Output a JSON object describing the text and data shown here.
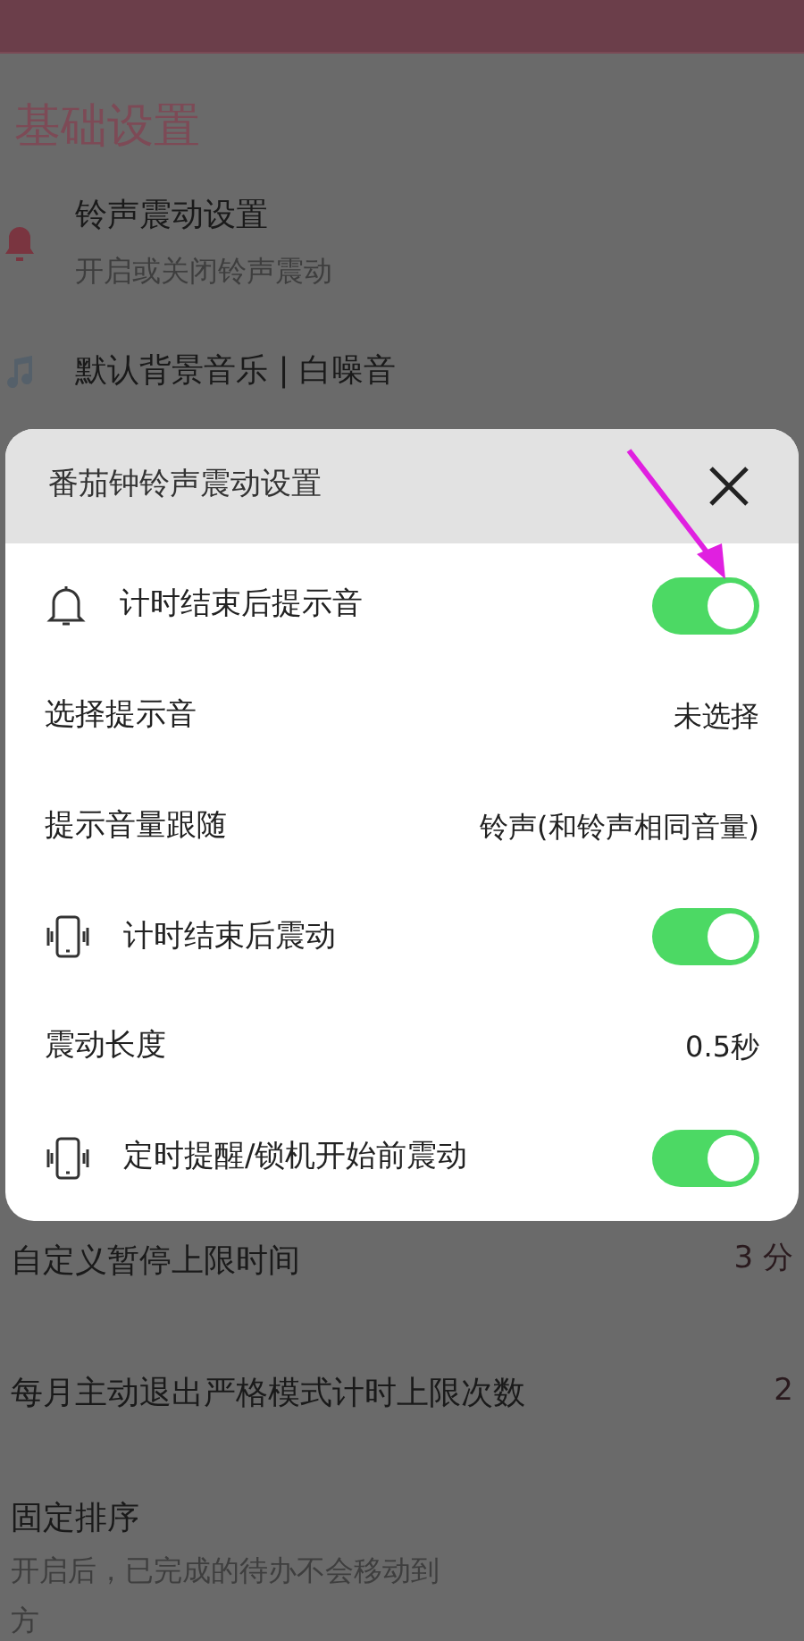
{
  "page": {
    "section_title": "基础设置",
    "items": [
      {
        "kind": "bell",
        "title": "铃声震动设置",
        "subtitle": "开启或关闭铃声震动"
      },
      {
        "kind": "music",
        "title": "默认背景音乐 | 白噪音"
      }
    ],
    "rows_below": [
      {
        "title": "自定义暂停上限时间",
        "value": "3 分"
      },
      {
        "title": "每月主动退出严格模式计时上限次数",
        "value": "2"
      },
      {
        "title": "固定排序",
        "lines": [
          "开启后，已完成的待办不会移动到",
          "方"
        ]
      }
    ]
  },
  "dialog": {
    "title": "番茄钟铃声震动设置",
    "rows": [
      {
        "kind": "bell_toggle",
        "label": "计时结束后提示音",
        "on": true
      },
      {
        "kind": "value",
        "label": "选择提示音",
        "value": "未选择"
      },
      {
        "kind": "value",
        "label": "提示音量跟随",
        "value": "铃声(和铃声相同音量)"
      },
      {
        "kind": "phone_toggle",
        "label": "计时结束后震动",
        "on": true
      },
      {
        "kind": "value",
        "label": "震动长度",
        "value": "0.5秒"
      },
      {
        "kind": "phone_toggle",
        "label": "定时提醒/锁机开始前震动",
        "on": true
      }
    ]
  }
}
